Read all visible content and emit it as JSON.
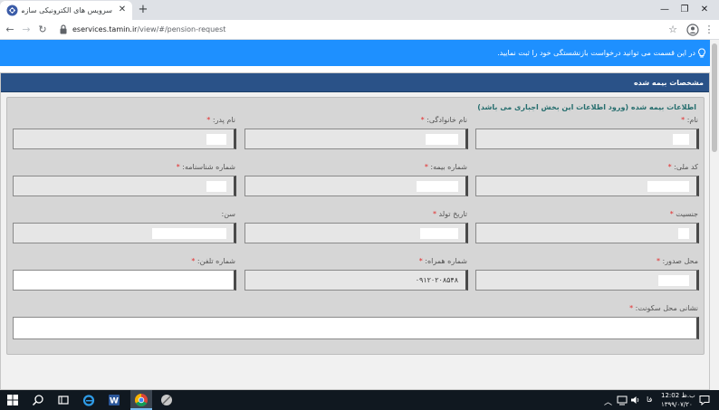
{
  "browser": {
    "tab_title": "سرویس های الکترونیکی سازمان تا...",
    "tab_close": "✕",
    "new_tab": "+",
    "url_host": "eservices.tamin.ir",
    "url_path": "/view/#/pension-request",
    "win_minimize": "—",
    "win_restore": "❐",
    "win_close": "✕"
  },
  "info_bar": {
    "text": "در این قسمت می توانید درخواست بازنشستگی خود را ثبت نمایید."
  },
  "panel": {
    "title": "مشخصات بیمه شده",
    "legend": "اطلاعات بیمه شده (ورود اطلاعات این بخش اجباری می باشد)"
  },
  "fields": {
    "first_name": {
      "label": "نام:",
      "required": "*"
    },
    "last_name": {
      "label": "نام خانوادگی:",
      "required": "*"
    },
    "father_name": {
      "label": "نام پدر:",
      "required": "*"
    },
    "national_code": {
      "label": "کد ملی:",
      "required": "*"
    },
    "insurance_number": {
      "label": "شماره بیمه:",
      "required": "*"
    },
    "id_number": {
      "label": "شماره شناسنامه:",
      "required": "*"
    },
    "gender": {
      "label": "جنسیت",
      "required": "*"
    },
    "birth_date": {
      "label": "تاریخ تولد",
      "required": "*"
    },
    "age": {
      "label": "سن:",
      "required": ""
    },
    "issue_place": {
      "label": "محل صدور:",
      "required": "*"
    },
    "mobile_number": {
      "label": "شماره همراه:",
      "required": "*",
      "value": "۰۹۱۲۰۲۰۸۵۴۸"
    },
    "phone_number": {
      "label": "شماره تلفن:",
      "required": "*",
      "value": ""
    },
    "address": {
      "label": "نشانی محل سکونت:",
      "required": "*",
      "value": ""
    }
  },
  "taskbar": {
    "clock_time": "12:02 ب.ظ",
    "clock_date": "۱۳۹۹/۰۷/۲۰",
    "lang": "فا"
  },
  "colors": {
    "info_bar": "#1e90ff",
    "panel_header": "#2a5288",
    "legend_text": "#266e6e",
    "required_star": "#e32d2d",
    "taskbar": "#101820"
  }
}
